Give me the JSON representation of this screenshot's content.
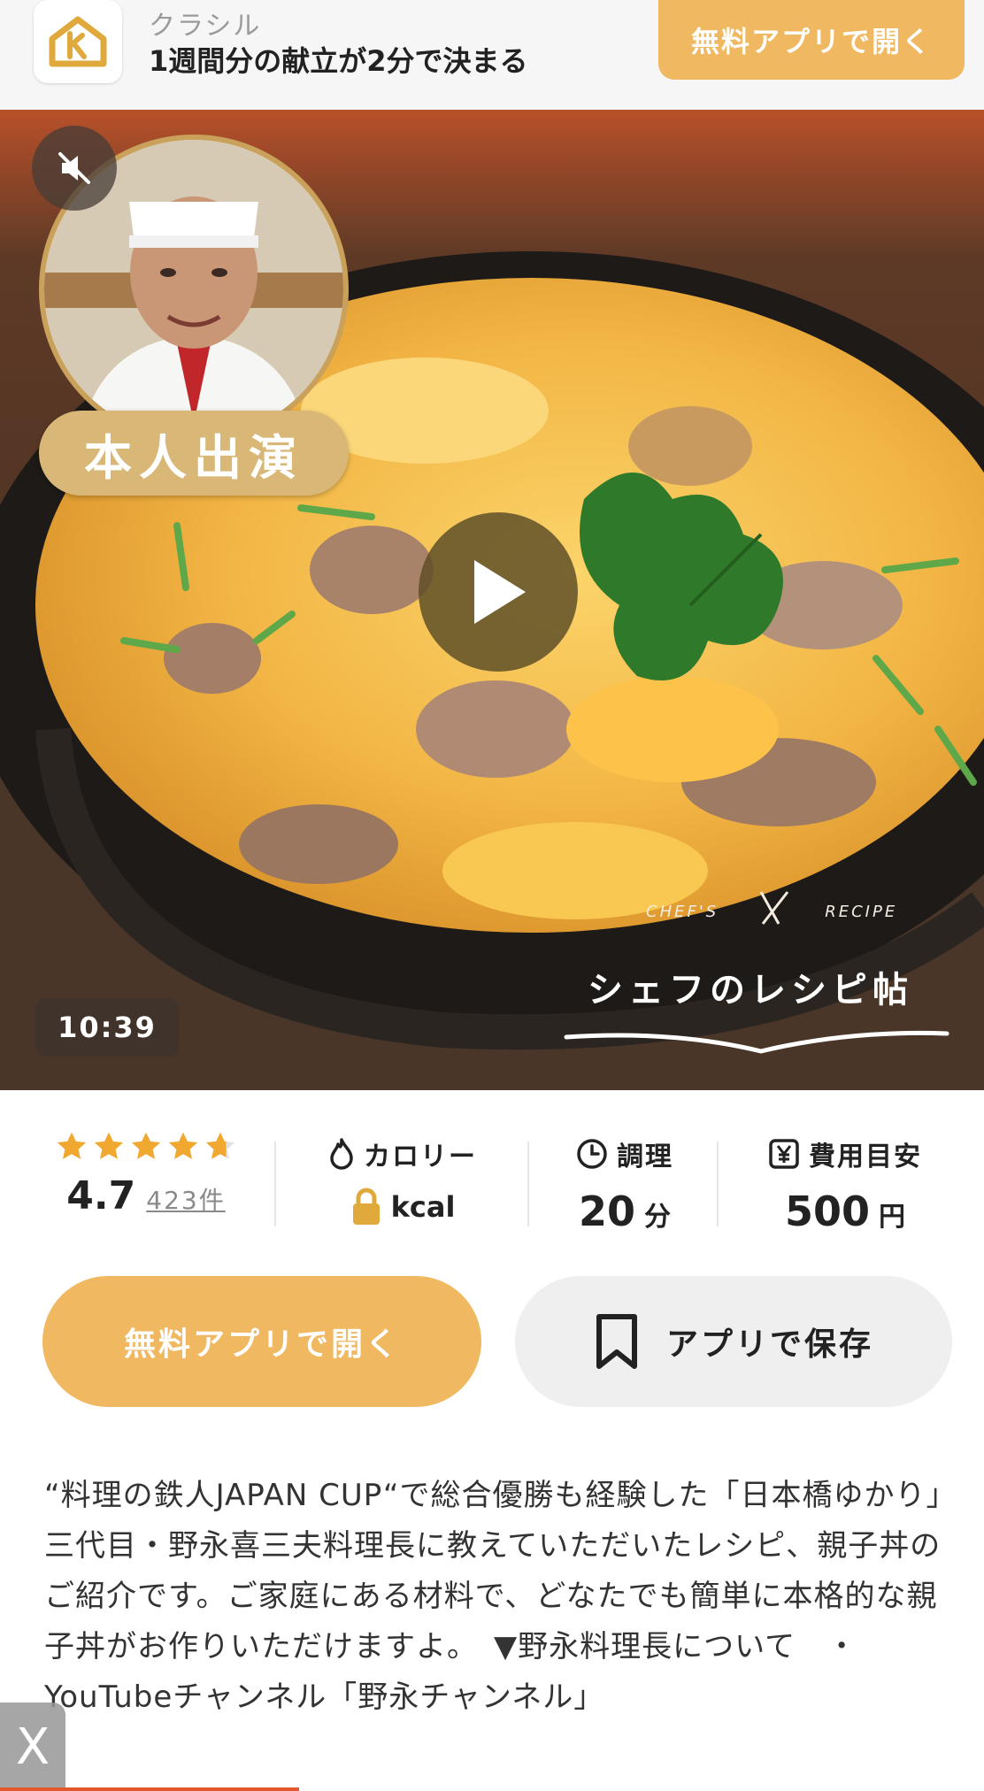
{
  "banner": {
    "app_name": "クラシル",
    "tagline": "1週間分の献立が2分で決まる",
    "cta_label": "無料アプリで開く",
    "logo_icon": "kurashiru-house-icon"
  },
  "video": {
    "duration": "10:39",
    "badge": "本人出演",
    "watermark_small_left": "CHEF'S",
    "watermark_small_right": "RECIPE",
    "watermark_title": "シェフのレシピ帖",
    "mute_icon": "muted-speaker-icon",
    "play_icon": "play-icon"
  },
  "stats": {
    "rating": {
      "value": "4.7",
      "count": "423件",
      "stars": 4.7
    },
    "calorie": {
      "label": "カロリー",
      "unit": "kcal",
      "icon": "flame-icon",
      "locked_icon": "lock-icon"
    },
    "cook_time": {
      "label": "調理",
      "value": "20",
      "unit": "分",
      "icon": "clock-icon"
    },
    "cost": {
      "label": "費用目安",
      "value": "500",
      "unit": "円",
      "icon": "yen-icon"
    }
  },
  "actions": {
    "open_label": "無料アプリで開く",
    "save_label": "アプリで保存",
    "save_icon": "bookmark-icon"
  },
  "description": "“料理の鉄人JAPAN CUP“で総合優勝も経験した「日本橋ゆかり」三代目・野永喜三夫料理長に教えていただいたレシピ、親子丼のご紹介です。ご家庭にある材料で、どなたでも簡単に本格的な親子丼がお作りいただけますよ。　▼野永料理長について　・YouTubeチャンネル「野永チャンネル」",
  "close_label": "X",
  "colors": {
    "accent": "#f0b860",
    "star": "#f0a830",
    "badge": "#d8b777"
  }
}
